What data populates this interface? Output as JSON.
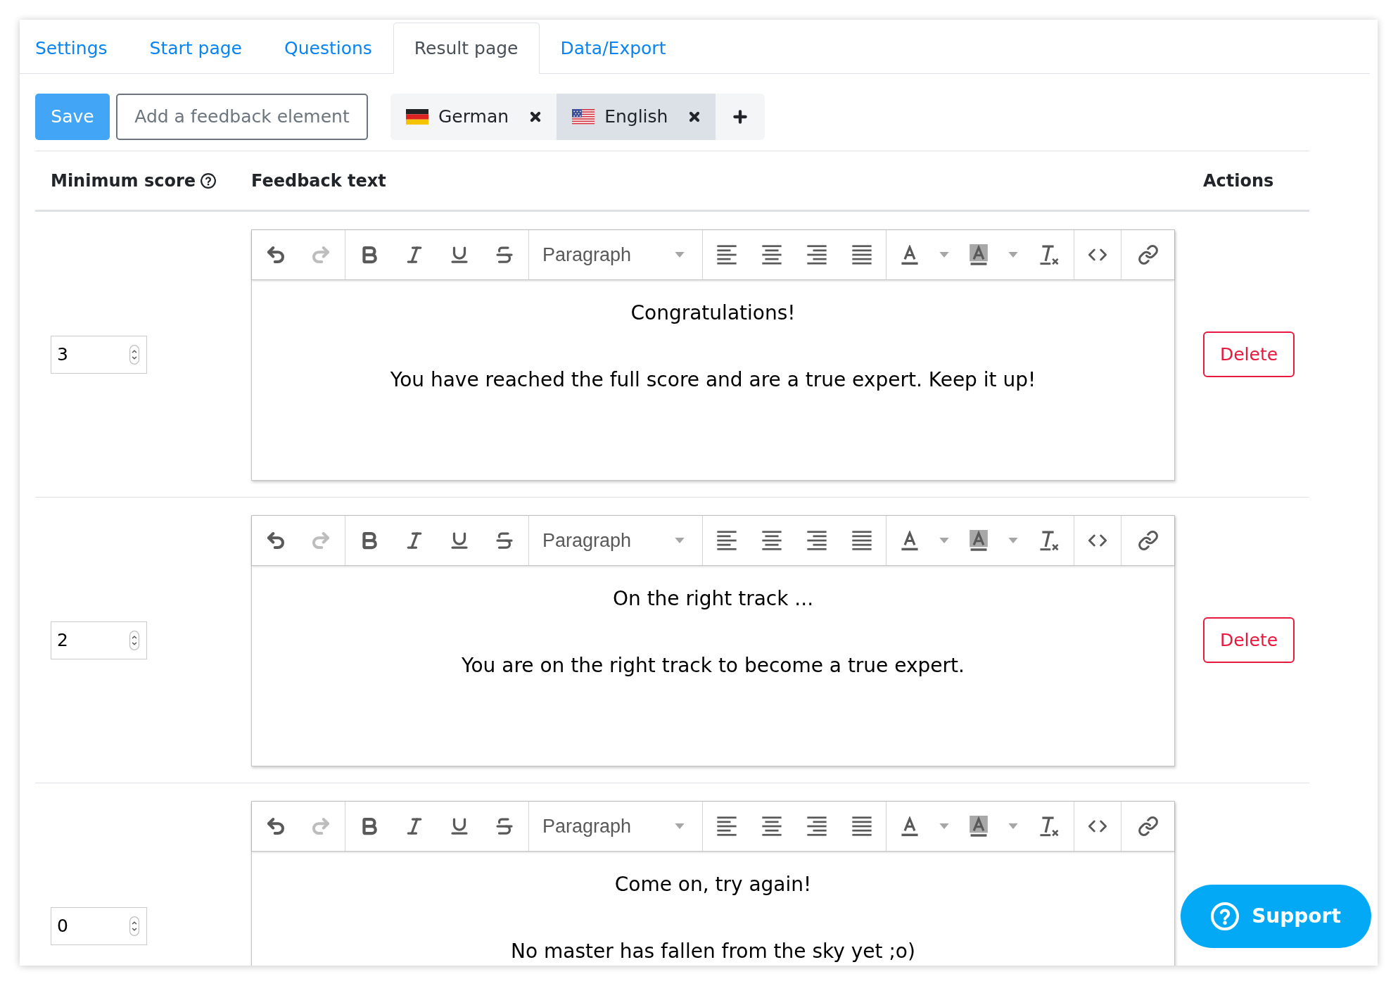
{
  "tabs": [
    {
      "label": "Settings",
      "selected": false
    },
    {
      "label": "Start page",
      "selected": false
    },
    {
      "label": "Questions",
      "selected": false
    },
    {
      "label": "Result page",
      "selected": true
    },
    {
      "label": "Data/Export",
      "selected": false
    }
  ],
  "toolbar": {
    "save": "Save",
    "add_element": "Add a feedback element",
    "languages": [
      {
        "kind": "de",
        "name": "German",
        "selected": false
      },
      {
        "kind": "us",
        "name": "English",
        "selected": true
      }
    ]
  },
  "table": {
    "columns": [
      {
        "label": "Minimum score",
        "help": true
      },
      {
        "label": "Feedback text",
        "help": false
      },
      {
        "label": "Actions",
        "help": false
      }
    ],
    "rows": [
      {
        "min_score": "3",
        "editor": {
          "history": [
            {
              "kind": "undo",
              "disabled": false
            },
            {
              "kind": "redo",
              "disabled": true
            }
          ],
          "block_format": "Paragraph",
          "paragraphs": [
            "Congratulations!",
            "You have reached the full score and are a true expert. Keep it up!"
          ]
        },
        "action": "Delete"
      },
      {
        "min_score": "2",
        "editor": {
          "history": [
            {
              "kind": "undo",
              "disabled": false
            },
            {
              "kind": "redo",
              "disabled": true
            }
          ],
          "block_format": "Paragraph",
          "paragraphs": [
            "On the right track ...",
            "You are on the right track to become a true expert."
          ]
        },
        "action": "Delete"
      },
      {
        "min_score": "0",
        "editor": {
          "history": [
            {
              "kind": "undo",
              "disabled": false
            },
            {
              "kind": "redo",
              "disabled": true
            }
          ],
          "block_format": "Paragraph",
          "paragraphs": [
            "Come on, try again!",
            "No master has fallen from the sky yet ;o)"
          ]
        }
      }
    ]
  },
  "support": {
    "label": "Support"
  }
}
